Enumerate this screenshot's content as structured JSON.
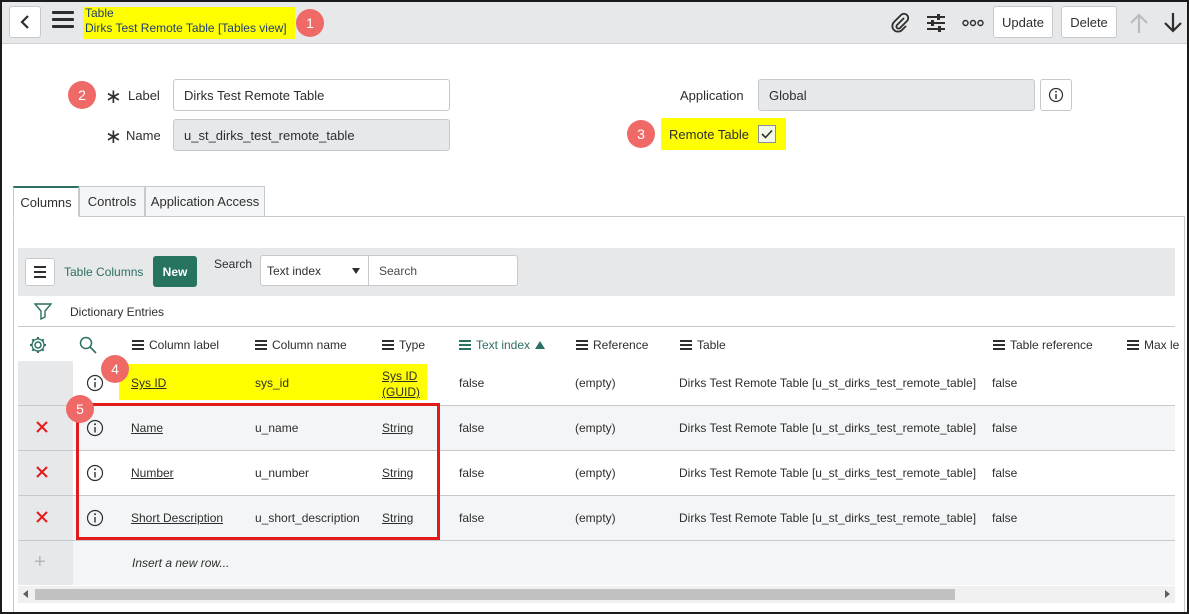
{
  "header": {
    "record_type": "Table",
    "record_title": "Dirks Test Remote Table [Tables view]",
    "update_label": "Update",
    "delete_label": "Delete"
  },
  "callouts": [
    "1",
    "2",
    "3",
    "4",
    "5"
  ],
  "form": {
    "label_label": "Label",
    "label_value": "Dirks Test Remote Table",
    "name_label": "Name",
    "name_value": "u_st_dirks_test_remote_table",
    "application_label": "Application",
    "application_value": "Global",
    "remote_table_label": "Remote Table",
    "remote_table_checked": true
  },
  "tabs": [
    "Columns",
    "Controls",
    "Application Access"
  ],
  "list": {
    "title": "Table Columns",
    "new_label": "New",
    "search_label": "Search",
    "search_field": "Text index",
    "search_placeholder": "Search",
    "breadcrumb": "Dictionary Entries",
    "columns": [
      "Column label",
      "Column name",
      "Type",
      "Text index",
      "Reference",
      "Table",
      "Table reference",
      "Max le"
    ],
    "sorted_column": "Text index",
    "rows": [
      {
        "column_label": "Sys ID",
        "column_name": "sys_id",
        "type": "Sys ID (GUID)",
        "type_line1": "Sys ID",
        "type_line2": "(GUID)",
        "text_index": "false",
        "reference": "(empty)",
        "table": "Dirks Test Remote Table [u_st_dirks_test_remote_table]",
        "table_reference": "false"
      },
      {
        "column_label": "Name",
        "column_name": "u_name",
        "type": "String",
        "text_index": "false",
        "reference": "(empty)",
        "table": "Dirks Test Remote Table [u_st_dirks_test_remote_table]",
        "table_reference": "false"
      },
      {
        "column_label": "Number",
        "column_name": "u_number",
        "type": "String",
        "text_index": "false",
        "reference": "(empty)",
        "table": "Dirks Test Remote Table [u_st_dirks_test_remote_table]",
        "table_reference": "false"
      },
      {
        "column_label": "Short Description",
        "column_name": "u_short_description",
        "type": "String",
        "text_index": "false",
        "reference": "(empty)",
        "table": "Dirks Test Remote Table [u_st_dirks_test_remote_table]",
        "table_reference": "false"
      }
    ],
    "insert_row_label": "Insert a new row..."
  },
  "colors": {
    "highlight": "#ffff00",
    "callout": "#ef6a67",
    "accent": "#2c6f64",
    "new_button": "#26735f",
    "annotation_box": "#e11b1b",
    "delete_x": "#e11b1b"
  }
}
